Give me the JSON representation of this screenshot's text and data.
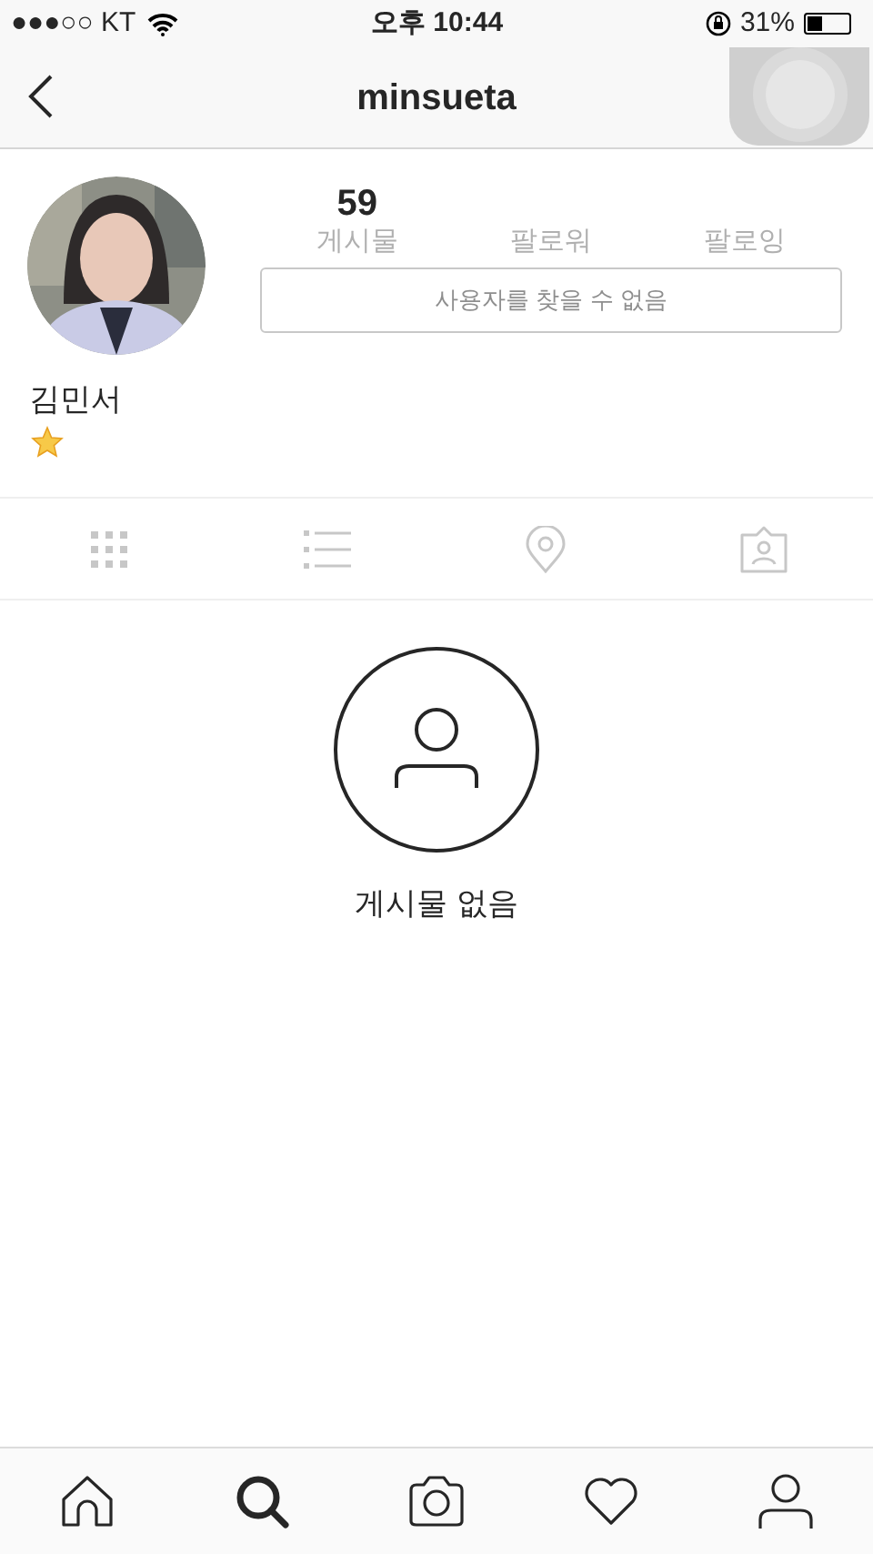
{
  "status_bar": {
    "carrier": "●●●○○ KT",
    "time": "오후 10:44",
    "battery": "31%"
  },
  "header": {
    "title": "minsueta"
  },
  "profile": {
    "stats": [
      {
        "value": "59",
        "label": "게시물"
      },
      {
        "label": "팔로워"
      },
      {
        "label": "팔로잉"
      }
    ],
    "button": "사용자를 찾을 수 없음",
    "name": "김민서"
  },
  "view_tabs": [
    {
      "kind": "grid",
      "selected": false
    },
    {
      "kind": "list",
      "selected": false
    },
    {
      "kind": "location",
      "selected": false
    },
    {
      "kind": "tagged",
      "selected": false
    }
  ],
  "empty_state": {
    "message": "게시물 없음"
  },
  "bottom_nav": [
    {
      "kind": "home",
      "selected": false
    },
    {
      "kind": "search",
      "selected": true
    },
    {
      "kind": "camera",
      "selected": false
    },
    {
      "kind": "heart",
      "selected": false
    },
    {
      "kind": "profile",
      "selected": false
    }
  ]
}
